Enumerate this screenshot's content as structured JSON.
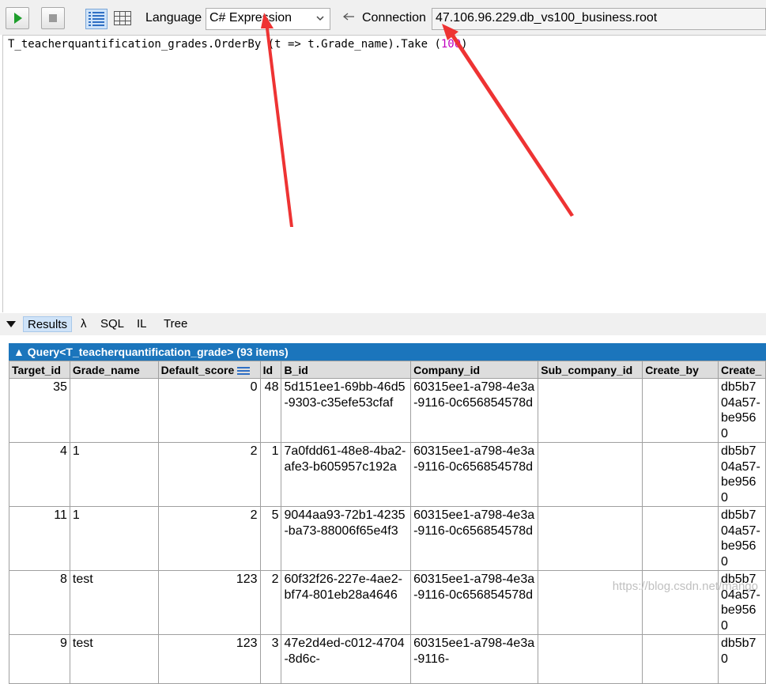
{
  "toolbar": {
    "language_label": "Language",
    "language_value": "C# Expression",
    "connection_label": "Connection",
    "connection_value": "47.106.96.229.db_vs100_business.root"
  },
  "editor": {
    "code_prefix": "T_teacherquantification_grades.OrderBy (t => t.Grade_name).Take (",
    "code_number": "100",
    "code_suffix": ")"
  },
  "result_tabs": [
    "Results",
    "λ",
    "SQL",
    "IL",
    "Tree"
  ],
  "grid": {
    "query_header": "Query<T_teacherquantification_grade> (93 items)",
    "columns": [
      "Target_id",
      "Grade_name",
      "Default_score",
      "Id",
      "B_id",
      "Company_id",
      "Sub_company_id",
      "Create_by",
      "Create_"
    ],
    "rows": [
      [
        "35",
        "",
        "0",
        "48",
        "5d151ee1-69bb-46d5-9303-c35efe53cfaf",
        "60315ee1-a798-4e3a-9116-0c656854578d",
        "",
        "",
        "db5b704a57-be9560"
      ],
      [
        "4",
        "1",
        "2",
        "1",
        "7a0fdd61-48e8-4ba2-afe3-b605957c192a",
        "60315ee1-a798-4e3a-9116-0c656854578d",
        "",
        "",
        "db5b704a57-be9560"
      ],
      [
        "11",
        "1",
        "2",
        "5",
        "9044aa93-72b1-4235-ba73-88006f65e4f3",
        "60315ee1-a798-4e3a-9116-0c656854578d",
        "",
        "",
        "db5b704a57-be9560"
      ],
      [
        "8",
        "test",
        "123",
        "2",
        "60f32f26-227e-4ae2-bf74-801eb28a4646",
        "60315ee1-a798-4e3a-9116-0c656854578d",
        "",
        "",
        "db5b704a57-be9560"
      ],
      [
        "9",
        "test",
        "123",
        "3",
        "47e2d4ed-c012-4704-8d6c-",
        "60315ee1-a798-4e3a-9116-",
        "",
        "",
        "db5b70"
      ]
    ]
  },
  "watermark": "https://blog.csdn.net/mango"
}
